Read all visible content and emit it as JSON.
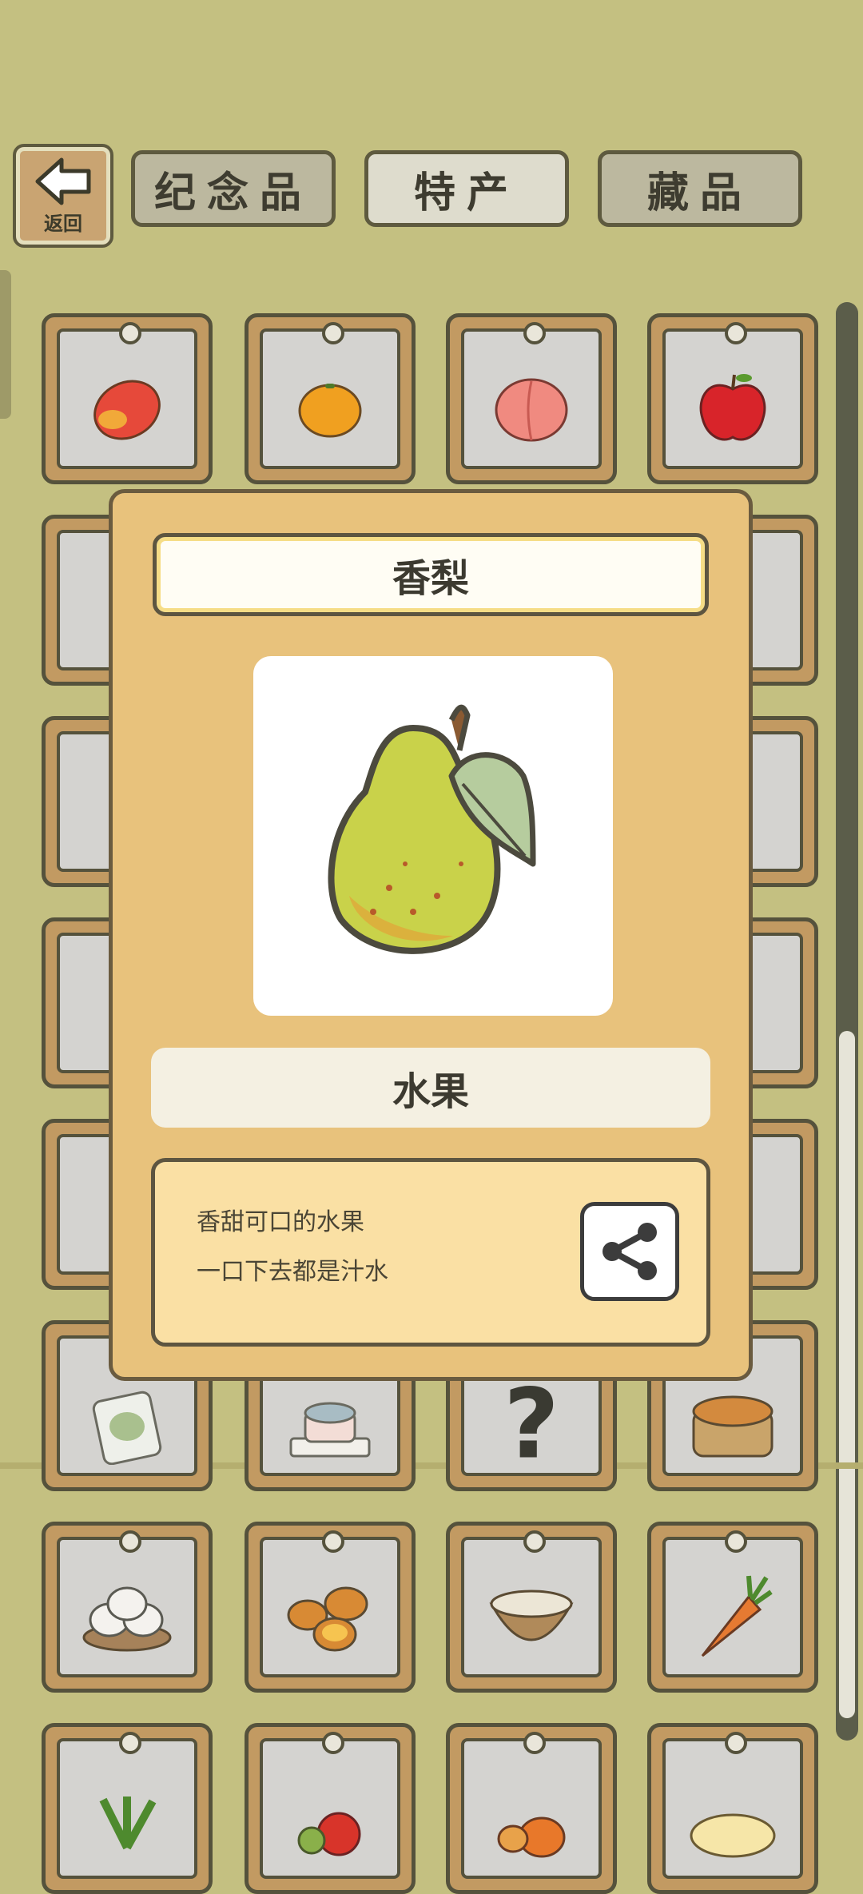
{
  "top_bar": {
    "back_label": "返回",
    "tabs": [
      {
        "label": "纪念品",
        "active": false
      },
      {
        "label": "特产",
        "active": true
      },
      {
        "label": "藏品",
        "active": false
      }
    ]
  },
  "grid": {
    "items": [
      {
        "name": "mango-icon"
      },
      {
        "name": "orange-icon"
      },
      {
        "name": "peach-icon"
      },
      {
        "name": "apple-icon"
      },
      {
        "name": "item-icon"
      },
      {
        "name": "item-icon"
      },
      {
        "name": "unknown-item-icon",
        "label": "?"
      },
      {
        "name": "bread-icon"
      },
      {
        "name": "dumplings-icon"
      },
      {
        "name": "egg-tarts-icon"
      },
      {
        "name": "porridge-icon"
      },
      {
        "name": "carrot-icon"
      },
      {
        "name": "radish-icon"
      },
      {
        "name": "tomato-icon"
      },
      {
        "name": "pumpkin-icon"
      },
      {
        "name": "noodles-icon"
      }
    ]
  },
  "modal": {
    "title": "香梨",
    "image": "pear-icon",
    "category": "水果",
    "description_lines": [
      "香甜可口的水果",
      "一口下去都是汁水"
    ],
    "share_icon": "share-icon"
  },
  "colors": {
    "background": "#c4c081",
    "modal_bg": "#e8c27c",
    "tile_wood": "#c29a62"
  }
}
